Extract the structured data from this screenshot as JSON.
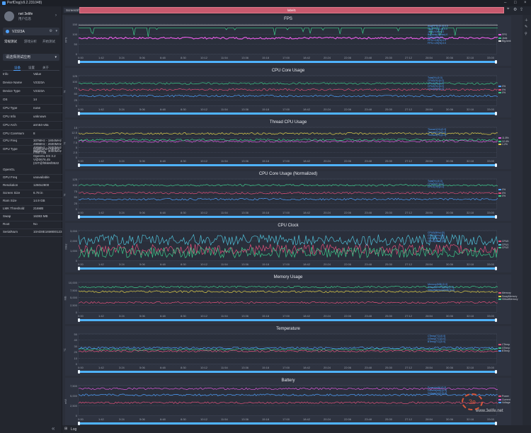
{
  "app": {
    "title": "PerfDog(v9.2.231048)"
  },
  "user": {
    "name": "net 3elife",
    "sub": "用户信息"
  },
  "device": {
    "name": "V2323A"
  },
  "modes": [
    {
      "label": "常规测试"
    },
    {
      "label": "游戏分析"
    },
    {
      "label": "开始测试"
    }
  ],
  "select": {
    "label": "请选择测试应用"
  },
  "infotabs": [
    {
      "label": "设备"
    },
    {
      "label": "设置"
    },
    {
      "label": "关于"
    }
  ],
  "info_header": {
    "k": "Info",
    "v": "Value"
  },
  "info": [
    {
      "k": "Device Name",
      "v": "V2323A"
    },
    {
      "k": "Device Type",
      "v": "V2323A"
    },
    {
      "k": "OS",
      "v": "14"
    },
    {
      "k": "CPU Type",
      "v": "none"
    },
    {
      "k": "CPU Info",
      "v": "unknown"
    },
    {
      "k": "CPU Arch",
      "v": "arm64-v8a"
    },
    {
      "k": "CPU CoreNum",
      "v": "8"
    },
    {
      "k": "CPU Freq",
      "v": "307MHz - 1804MHz\n499MHz - 2600MHz\n499MHz - 2600MHz\n595MHz - 3000MHz"
    },
    {
      "k": "GPU Type",
      "v": "Qualcomm Adreno\n(TM) 735\nOpenGL ES 3.2\nV@0676.45\n(GIT@f0bb6f3522"
    },
    {
      "k": "OpenGL",
      "v": ""
    },
    {
      "k": "GPU Freq",
      "v": "unavailable"
    },
    {
      "k": "Resolution",
      "v": "1260x2800"
    },
    {
      "k": "Screen Size",
      "v": "6.78 in"
    },
    {
      "k": "Ram Size",
      "v": "14.9 GB"
    },
    {
      "k": "LMK Threshold",
      "v": "216MB"
    },
    {
      "k": "Swap",
      "v": "16383 MB"
    },
    {
      "k": "Root",
      "v": "No"
    },
    {
      "k": "SerialNum",
      "v": "10AD8E16M800123"
    }
  ],
  "toolbar": {
    "screenshot": "ScreenShot",
    "label": "label1"
  },
  "bottom": {
    "log": "Log"
  },
  "watermark": "www.3elife.net",
  "xticks": [
    "0:00",
    "1:42",
    "3:24",
    "5:06",
    "6:48",
    "8:30",
    "10:12",
    "11:54",
    "13:36",
    "15:18",
    "17:00",
    "18:42",
    "20:24",
    "22:06",
    "23:48",
    "25:30",
    "27:12",
    "28:54",
    "30:36",
    "32:18",
    "33:00"
  ],
  "panels": [
    {
      "title": "FPS",
      "ylabel": "FPS",
      "yticks": [
        "150",
        "100",
        "50",
        "0"
      ],
      "readout": "Avg(FPS):[0.0]:0.0\nVar(FPS):[0.0]:0.0\nJank(/10min):0\nBigJank(/10min):0\nStutter(%):0.0\nFPS>=18(%):0.0\nFPS>=25(%):0.0",
      "legend": [
        {
          "c": "#e05ae0",
          "t": "FPS"
        },
        {
          "c": "#3cc98a",
          "t": "Jank"
        },
        {
          "c": "#e0e0e0",
          "t": "BigJank"
        }
      ]
    },
    {
      "title": "CPU Core Usage",
      "ylabel": "%",
      "yticks": [
        "125",
        "100",
        "75",
        "50",
        "25",
        "0"
      ],
      "readout": "Total(%):[0.0]\nCPU0(%):[0.0]\nCPU1(%):[0.0]\nCPU2(%):[0.0]\nCPU3(%):[0.0]",
      "legend": [
        {
          "c": "#4ea1ff",
          "t": "0%"
        },
        {
          "c": "#e0507a",
          "t": "0%"
        },
        {
          "c": "#3cc98a",
          "t": "0%"
        }
      ]
    },
    {
      "title": "Thread CPU Usage",
      "ylabel": "%",
      "yticks": [
        "15",
        "12.5",
        "10",
        "7.5",
        "5",
        "2.5",
        "0"
      ],
      "readout": "Thread1(%):[0.0]\nThread2(%):[0.0]\nThread3(%):[0.0]",
      "legend": [
        {
          "c": "#e05ae0",
          "t": "11.8%"
        },
        {
          "c": "#3cc98a",
          "t": "12.4%"
        },
        {
          "c": "#e0d04a",
          "t": "1.2%"
        }
      ]
    },
    {
      "title": "CPU Core Usage (Normalized)",
      "ylabel": "%",
      "yticks": [
        "125",
        "100",
        "75",
        "50",
        "25",
        "0"
      ],
      "readout": "Total(%):[0.0]\nCPU0(%):[0.0]\nCPU1(%):[0.0]",
      "legend": [
        {
          "c": "#4ea1ff",
          "t": "0%"
        },
        {
          "c": "#e0507a",
          "t": "0%"
        },
        {
          "c": "#3cc98a",
          "t": "0%"
        }
      ]
    },
    {
      "title": "CPU Clock",
      "ylabel": "MHz",
      "yticks": [
        "3,000",
        "2,000",
        "1,000",
        "0"
      ],
      "readout": "CPU0(MHz):[0]\nCPU1(MHz):[0]\nCPU2(MHz):[0]\nCPU3(MHz):[0]",
      "legend": [
        {
          "c": "#e0507a",
          "t": "CPU0"
        },
        {
          "c": "#4fc0d8",
          "t": "CPU1"
        },
        {
          "c": "#3cc98a",
          "t": "CPU2"
        }
      ]
    },
    {
      "title": "Memory Usage",
      "ylabel": "MB",
      "yticks": [
        "10,000",
        "7,500",
        "5,000",
        "2,500",
        "0"
      ],
      "readout": "Memory(MB):[0.0]\nSwapMemory(MB):[0.0]\nVirtualMemory(MB):[0.0]",
      "legend": [
        {
          "c": "#e0507a",
          "t": "Memory"
        },
        {
          "c": "#e0d04a",
          "t": "SwapMemory"
        },
        {
          "c": "#3cc98a",
          "t": "VirtualMemory"
        }
      ]
    },
    {
      "title": "Temperature",
      "ylabel": "°C",
      "yticks": [
        "50",
        "40",
        "30",
        "20",
        "10",
        "0"
      ],
      "readout": "CTemp(°C):[0.0]\nGTemp(°C):[0.0]\nBTemp(°C):[0.0]",
      "legend": [
        {
          "c": "#e0507a",
          "t": "CTemp"
        },
        {
          "c": "#3cc98a",
          "t": "GTemp"
        },
        {
          "c": "#4ea1ff",
          "t": "BTemp"
        }
      ]
    },
    {
      "title": "Battery",
      "ylabel": "mW",
      "yticks": [
        "7,500",
        "5,000",
        "2,500",
        "0"
      ],
      "readout": "Power(mW):[0.0]\nCurrent(mA):[0.0]\nVoltage(mV):[0.0]",
      "legend": [
        {
          "c": "#e0507a",
          "t": "Power"
        },
        {
          "c": "#e05ae0",
          "t": "Current"
        },
        {
          "c": "#4ea1ff",
          "t": "Voltage"
        }
      ]
    }
  ],
  "colors": {
    "accent": "#4ea1ff",
    "label_bar": "#c85a6e",
    "scrub": "#4fb3ff"
  }
}
